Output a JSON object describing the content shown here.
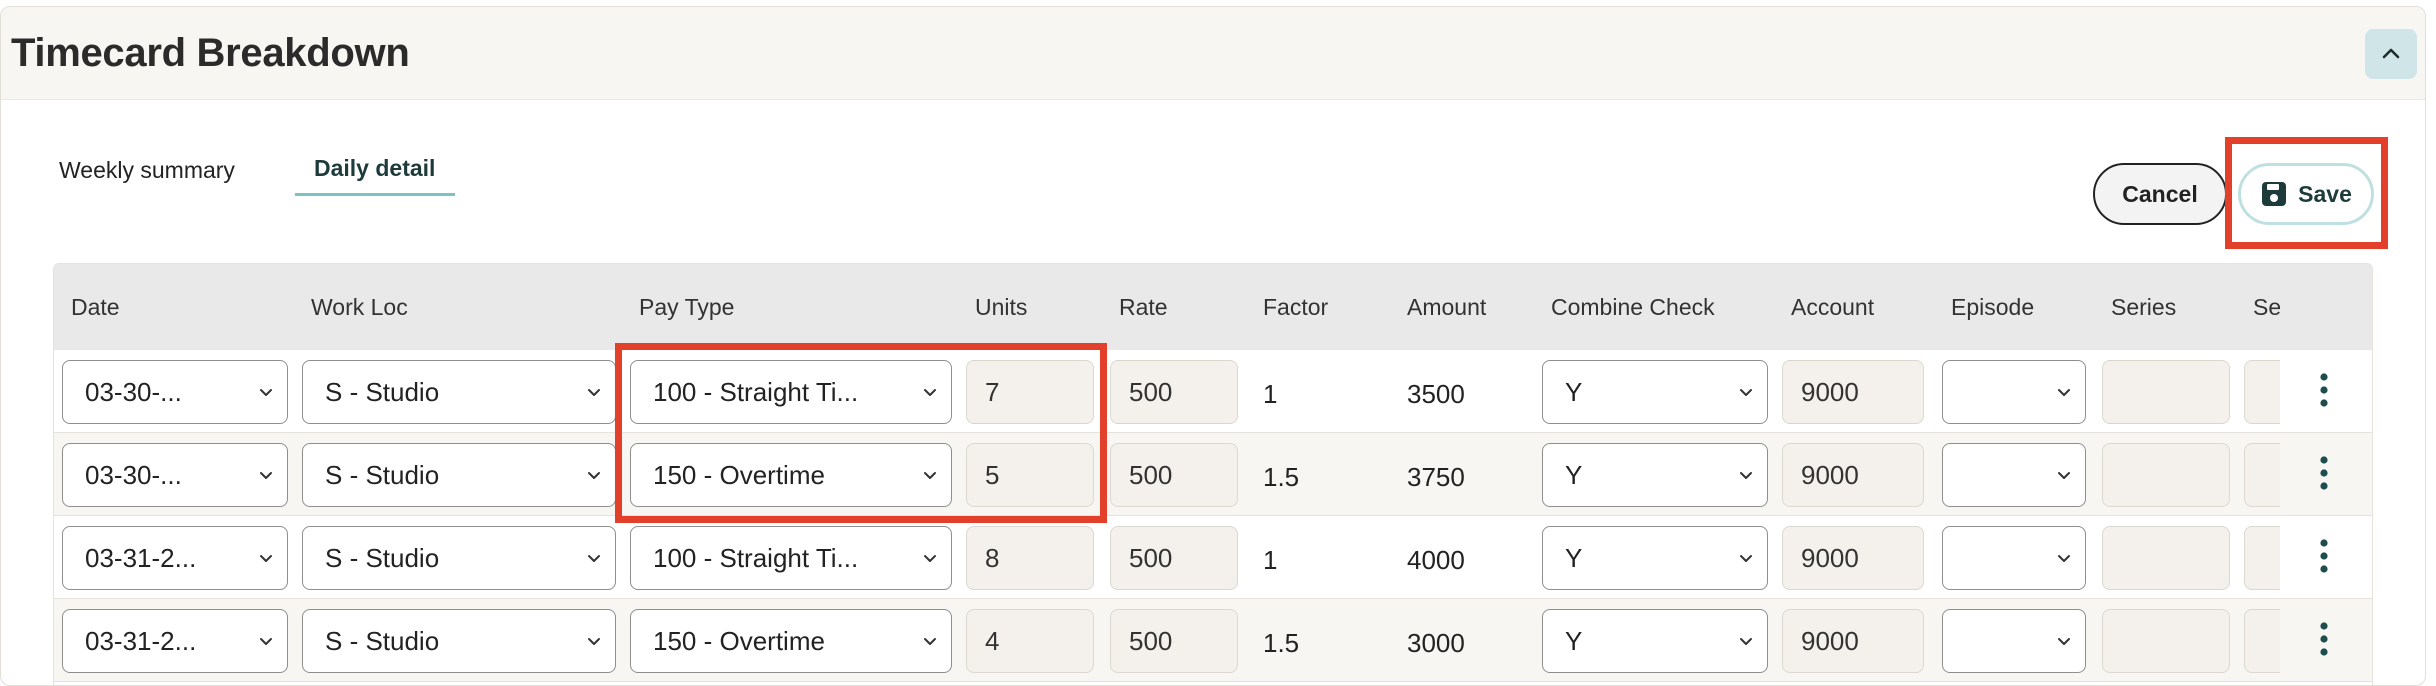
{
  "header": {
    "title": "Timecard Breakdown",
    "collapse_icon": "chevron-up-icon"
  },
  "tabs": [
    {
      "label": "Weekly summary",
      "active": false
    },
    {
      "label": "Daily detail",
      "active": true
    }
  ],
  "actions": {
    "cancel_label": "Cancel",
    "save_label": "Save",
    "save_icon": "floppy-disk-icon"
  },
  "table": {
    "columns": [
      "Date",
      "Work Loc",
      "Pay Type",
      "Units",
      "Rate",
      "Factor",
      "Amount",
      "Combine Check",
      "Account",
      "Episode",
      "Series",
      "Se"
    ],
    "rows": [
      {
        "date": "03-30-...",
        "work_loc": "S - Studio",
        "pay_type": "100 - Straight Ti...",
        "units": "7",
        "rate": "500",
        "factor": "1",
        "amount": "3500",
        "combine_check": "Y",
        "account": "9000",
        "episode": "",
        "series": ""
      },
      {
        "date": "03-30-...",
        "work_loc": "S - Studio",
        "pay_type": "150 - Overtime",
        "units": "5",
        "rate": "500",
        "factor": "1.5",
        "amount": "3750",
        "combine_check": "Y",
        "account": "9000",
        "episode": "",
        "series": ""
      },
      {
        "date": "03-31-2...",
        "work_loc": "S - Studio",
        "pay_type": "100 - Straight Ti...",
        "units": "8",
        "rate": "500",
        "factor": "1",
        "amount": "4000",
        "combine_check": "Y",
        "account": "9000",
        "episode": "",
        "series": ""
      },
      {
        "date": "03-31-2...",
        "work_loc": "S - Studio",
        "pay_type": "150 - Overtime",
        "units": "4",
        "rate": "500",
        "factor": "1.5",
        "amount": "3000",
        "combine_check": "Y",
        "account": "9000",
        "episode": "",
        "series": ""
      }
    ]
  },
  "colors": {
    "highlight": "#e2402b",
    "accent": "#7cc3c3",
    "dots": "#1e4d4d"
  }
}
